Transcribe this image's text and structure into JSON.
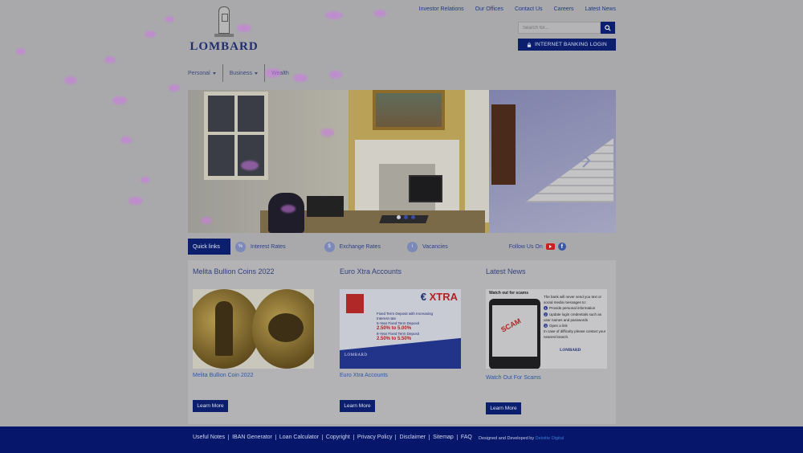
{
  "top_links": [
    "Investor Relations",
    "Our Offices",
    "Contact Us",
    "Careers",
    "Latest News"
  ],
  "logo": {
    "wordmark": "LOMBARD"
  },
  "search": {
    "placeholder": "Search for...",
    "icon": "search-icon"
  },
  "internet_banking": {
    "label": "INTERNET BANKING LOGIN",
    "icon": "lock-icon"
  },
  "main_nav": [
    {
      "label": "Personal",
      "has_caret": true
    },
    {
      "label": "Business",
      "has_caret": true
    },
    {
      "label": "Wealth",
      "has_caret": false
    }
  ],
  "quick_links": {
    "label": "Quick links",
    "items": [
      {
        "label": "Interest Rates",
        "icon": "percent-icon"
      },
      {
        "label": "Exchange Rates",
        "icon": "exchange-icon"
      },
      {
        "label": "Vacancies",
        "icon": "vacancies-icon"
      }
    ],
    "follow_label": "Follow Us On",
    "social": [
      "youtube-icon",
      "facebook-icon"
    ]
  },
  "panels": [
    {
      "title": "Melita Bullion Coins 2022",
      "caption": "Melita Bullion Coin 2022",
      "button": "Learn More"
    },
    {
      "title": "Euro Xtra Accounts",
      "caption": "Euro Xtra Accounts",
      "button": "Learn More"
    },
    {
      "title": "Latest News",
      "caption": "Watch Out For Scams",
      "button": "Learn More"
    }
  ],
  "xtra_ad": {
    "brand": "XTRA",
    "line1": "Fixed Term Deposit with Increasing Interest rate",
    "line2": "5-Year Fixed Term Deposit",
    "rate1": "2.50% to 5.00%",
    "line3": "8-Year Fixed Term Deposit",
    "rate2": "2.50% to 5.50%",
    "logo": "LOMBARD"
  },
  "scam_ad": {
    "title": "Watch out for scams",
    "stamp": "SCAM",
    "intro": "The bank will never send you text or social media messages to:",
    "points": [
      "Provide personal information",
      "Update login credentials such as user names and passwords",
      "Open a link"
    ],
    "outro": "In case of difficulty please contact your nearest branch.",
    "logo": "LOMBARD"
  },
  "footer": {
    "links": [
      "Useful Notes",
      "IBAN Generator",
      "Loan Calculator",
      "Copyright",
      "Privacy Policy",
      "Disclaimer",
      "Sitemap",
      "FAQ"
    ],
    "credit_prefix": "Designed and Developed by",
    "credit_brand": "Deloitte Digital"
  },
  "colors": {
    "brand_navy": "#0b1f6e",
    "link_blue": "#2f56a8",
    "overlay_gray": "#a9a9ac"
  }
}
